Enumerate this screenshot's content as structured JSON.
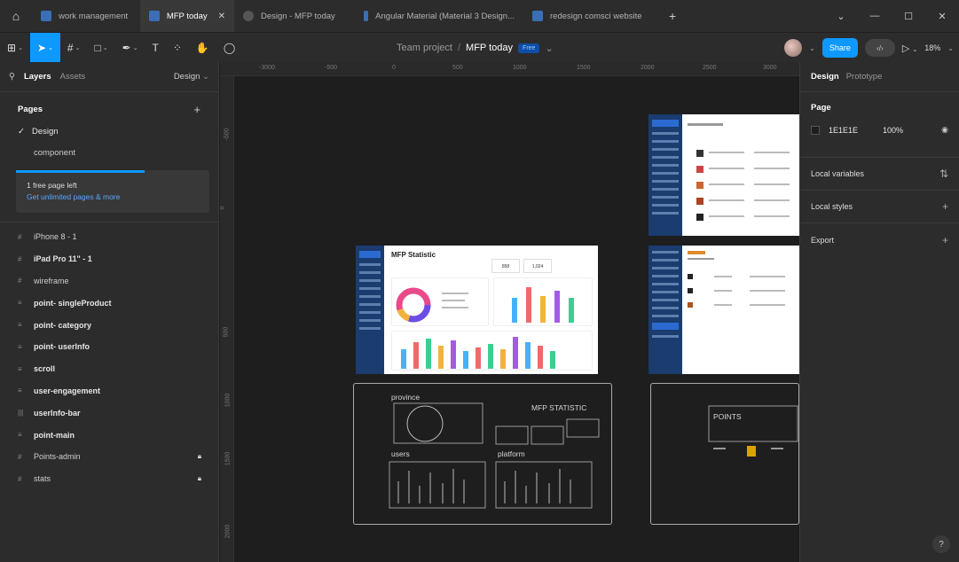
{
  "tabs": [
    {
      "label": "work management"
    },
    {
      "label": "MFP today"
    },
    {
      "label": "Design - MFP today"
    },
    {
      "label": "Angular Material (Material 3 Design..."
    },
    {
      "label": "redesign comsci website"
    }
  ],
  "toolbar": {
    "team": "Team project",
    "sep": "/",
    "file": "MFP today",
    "plan_badge": "Free",
    "share": "Share",
    "zoom": "18%"
  },
  "left_panel": {
    "tab_layers": "Layers",
    "tab_assets": "Assets",
    "design_dropdown": "Design",
    "pages_header": "Pages",
    "pages": [
      {
        "label": "Design"
      },
      {
        "label": "component"
      }
    ],
    "upsell_text": "1 free page left",
    "upsell_link": "Get unlimited pages & more",
    "layers": [
      {
        "label": "iPhone 8 - 1",
        "icon": "#"
      },
      {
        "label": "iPad Pro 11\" - 1",
        "icon": "#"
      },
      {
        "label": "wireframe",
        "icon": "#"
      },
      {
        "label": "point- singleProduct",
        "icon": "≡"
      },
      {
        "label": "point- category",
        "icon": "≡"
      },
      {
        "label": "point- userInfo",
        "icon": "≡"
      },
      {
        "label": "scroll",
        "icon": "≡"
      },
      {
        "label": "user-engagement",
        "icon": "≡"
      },
      {
        "label": "userInfo-bar",
        "icon": "|||"
      },
      {
        "label": "point-main",
        "icon": "≡"
      },
      {
        "label": "Points-admin",
        "icon": "#"
      },
      {
        "label": "stats",
        "icon": "#"
      }
    ]
  },
  "canvas": {
    "ruler_top": [
      "-3000",
      "-500",
      "0",
      "500",
      "1000",
      "1500",
      "2000",
      "2500",
      "3000"
    ],
    "ruler_left": [
      "-500",
      "0",
      "500",
      "1000",
      "1500",
      "2000"
    ],
    "statistic_title": "MFP Statistic",
    "stat1": "858",
    "stat2": "1,024",
    "sketch_province": "province",
    "sketch_mfp": "MFP STATISTIC",
    "sketch_users": "users",
    "sketch_platform": "platform",
    "sketch_points": "POINTS"
  },
  "right_panel": {
    "tab_design": "Design",
    "tab_prototype": "Prototype",
    "page_header": "Page",
    "page_color": "1E1E1E",
    "page_opacity": "100%",
    "local_variables": "Local variables",
    "local_styles": "Local styles",
    "export": "Export",
    "help": "?"
  },
  "colors": {
    "accent": "#0d99ff",
    "canvas_bg": "#1e1e1e",
    "panel_bg": "#2c2c2c",
    "sidebar_blue": "#1a3c6e"
  }
}
